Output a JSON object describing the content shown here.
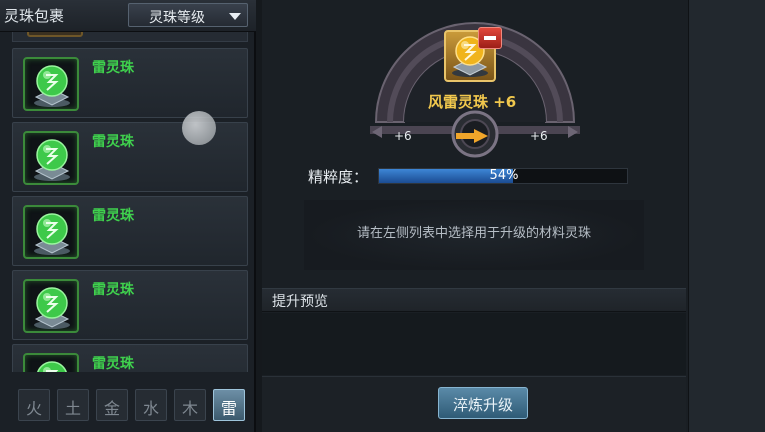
{
  "left_panel": {
    "title": "灵珠包裹",
    "sort_dropdown": {
      "label": "灵珠等级"
    },
    "items": [
      {
        "name": "雷灵珠"
      },
      {
        "name": "雷灵珠"
      },
      {
        "name": "雷灵珠"
      },
      {
        "name": "雷灵珠"
      },
      {
        "name": "雷灵珠"
      }
    ],
    "filters": [
      {
        "glyph": "火",
        "icon": "fire-element-icon"
      },
      {
        "glyph": "土",
        "icon": "earth-element-icon"
      },
      {
        "glyph": "金",
        "icon": "metal-element-icon"
      },
      {
        "glyph": "水",
        "icon": "water-element-icon"
      },
      {
        "glyph": "木",
        "icon": "wood-element-icon"
      },
      {
        "glyph": "雷",
        "icon": "thunder-element-icon"
      }
    ],
    "active_filter_index": 5
  },
  "upgrade": {
    "item_title": "风雷灵珠 +6",
    "current_level": "+6",
    "next_level": "+6",
    "essence_label": "精粹度：",
    "essence_value": "54%",
    "essence_fraction": 0.54,
    "hint": "请在左侧列表中选择用于升级的材料灵珠"
  },
  "preview": {
    "title": "提升预览"
  },
  "actions": {
    "refine_label": "淬炼升级"
  },
  "colors": {
    "item_name": "#3fd14d",
    "title_gold": "#f1c84d",
    "progress_blue": "#2f6fc0",
    "active_filter": "#5a8aa8"
  }
}
